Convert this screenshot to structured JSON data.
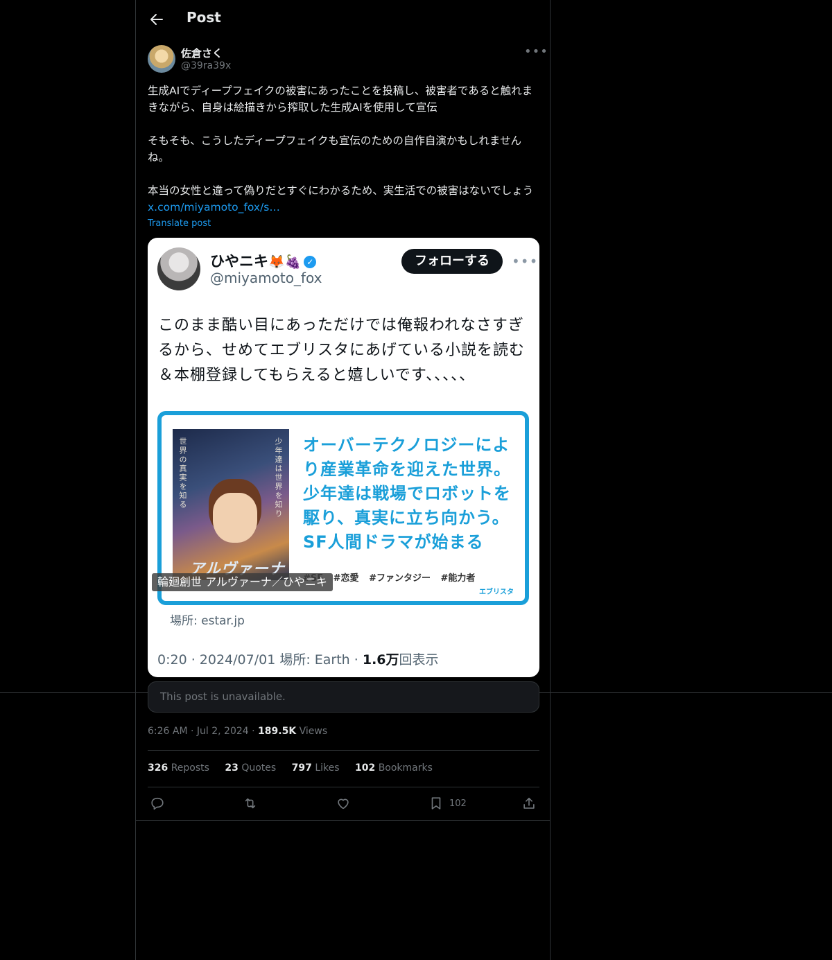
{
  "header": {
    "title": "Post"
  },
  "author": {
    "name": "佐倉さく",
    "handle": "@39ra39x"
  },
  "post": {
    "paragraphs": [
      "生成AIでディープフェイクの被害にあったことを投稿し、被害者であると触れまきながら、自身は絵描きから搾取した生成AIを使用して宣伝",
      "そもそも、こうしたディープフェイクも宣伝のための自作自演かもしれませんね。",
      "本当の女性と違って偽りだとすぐにわかるため、実生活での被害はないでしょう"
    ],
    "link_text": "x.com/miyamoto_fox/s…",
    "translate_label": "Translate post"
  },
  "quoted": {
    "name": "ひやニキ",
    "emoji": "🦊🍇",
    "handle": "@miyamoto_fox",
    "follow_label": "フォローする",
    "text": "このまま酷い目にあっただけでは俺報われなさすぎるから、せめてエブリスタにあげている小説を読む＆本棚登録してもらえると嬉しいです、、、、、",
    "ad": {
      "side_left": "世界の真実を知る",
      "side_right": "少年達は世界を知り",
      "art_title": "アルヴァーナ",
      "headline": "オーバーテクノロジーにより産業革命を迎えた世界。少年達は戦場でロボットを駆り、真実に立ち向かう。SF人間ドラマが始まる",
      "tags": "#SF #恋愛 #ファンタジー #能力者",
      "brand": "エブリスタ",
      "caption": "輪廻創世 アルヴァーナ／ひやニキ"
    },
    "domain": "場所: estar.jp",
    "meta_prefix": "0:20 · 2024/07/01 場所: Earth · ",
    "meta_views": "1.6万",
    "meta_suffix": "回表示"
  },
  "unavailable": "This post is unavailable.",
  "meta": {
    "time": "6:26 AM",
    "date": "Jul 2, 2024",
    "views": "189.5K",
    "views_label": "Views"
  },
  "stats": [
    {
      "count": "326",
      "label": "Reposts"
    },
    {
      "count": "23",
      "label": "Quotes"
    },
    {
      "count": "797",
      "label": "Likes"
    },
    {
      "count": "102",
      "label": "Bookmarks"
    }
  ],
  "actions": {
    "bookmark_count": "102"
  },
  "icons": [
    "back-arrow-icon",
    "more-icon",
    "verified-badge-icon",
    "reply-icon",
    "repost-icon",
    "like-icon",
    "bookmark-icon",
    "share-icon"
  ]
}
